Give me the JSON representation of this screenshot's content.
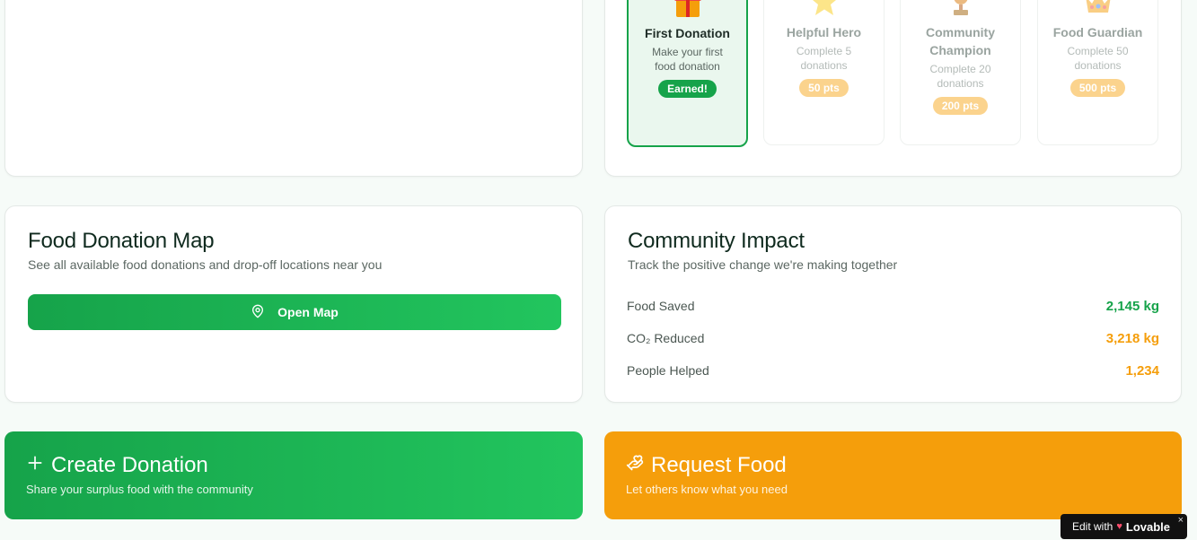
{
  "achievements": {
    "badges": [
      {
        "title": "First Donation",
        "description": "Make your first food donation",
        "pill": "Earned!",
        "icon": "gift-icon",
        "state": "earned"
      },
      {
        "title": "Helpful Hero",
        "description": "Complete 5 donations",
        "pill": "50 pts",
        "icon": "star-icon",
        "state": "locked"
      },
      {
        "title": "Community Champion",
        "description": "Complete 20 donations",
        "pill": "200 pts",
        "icon": "trophy-icon",
        "state": "locked"
      },
      {
        "title": "Food Guardian",
        "description": "Complete 50 donations",
        "pill": "500 pts",
        "icon": "crown-icon",
        "state": "locked"
      }
    ]
  },
  "map": {
    "title": "Food Donation Map",
    "subtitle": "See all available food donations and drop-off locations near you",
    "button_label": "Open Map"
  },
  "impact": {
    "title": "Community Impact",
    "subtitle": "Track the positive change we're making together",
    "metrics": [
      {
        "label": "Food Saved",
        "value": "2,145 kg",
        "color": "#16a34a"
      },
      {
        "label": "CO₂ Reduced",
        "value": "3,218 kg",
        "color": "#f59e0b"
      },
      {
        "label": "People Helped",
        "value": "1,234",
        "color": "#f59e0b"
      }
    ]
  },
  "actions": {
    "create": {
      "title": "Create Donation",
      "subtitle": "Share your surplus food with the community",
      "icon": "plus-icon"
    },
    "request": {
      "title": "Request Food",
      "subtitle": "Let others know what you need",
      "icon": "hand-heart-icon"
    }
  },
  "lovable": {
    "prefix": "Edit with",
    "brand": "Lovable"
  },
  "colors": {
    "green": "#16a34a",
    "green_light": "#22c55e",
    "orange": "#f59e0b"
  }
}
